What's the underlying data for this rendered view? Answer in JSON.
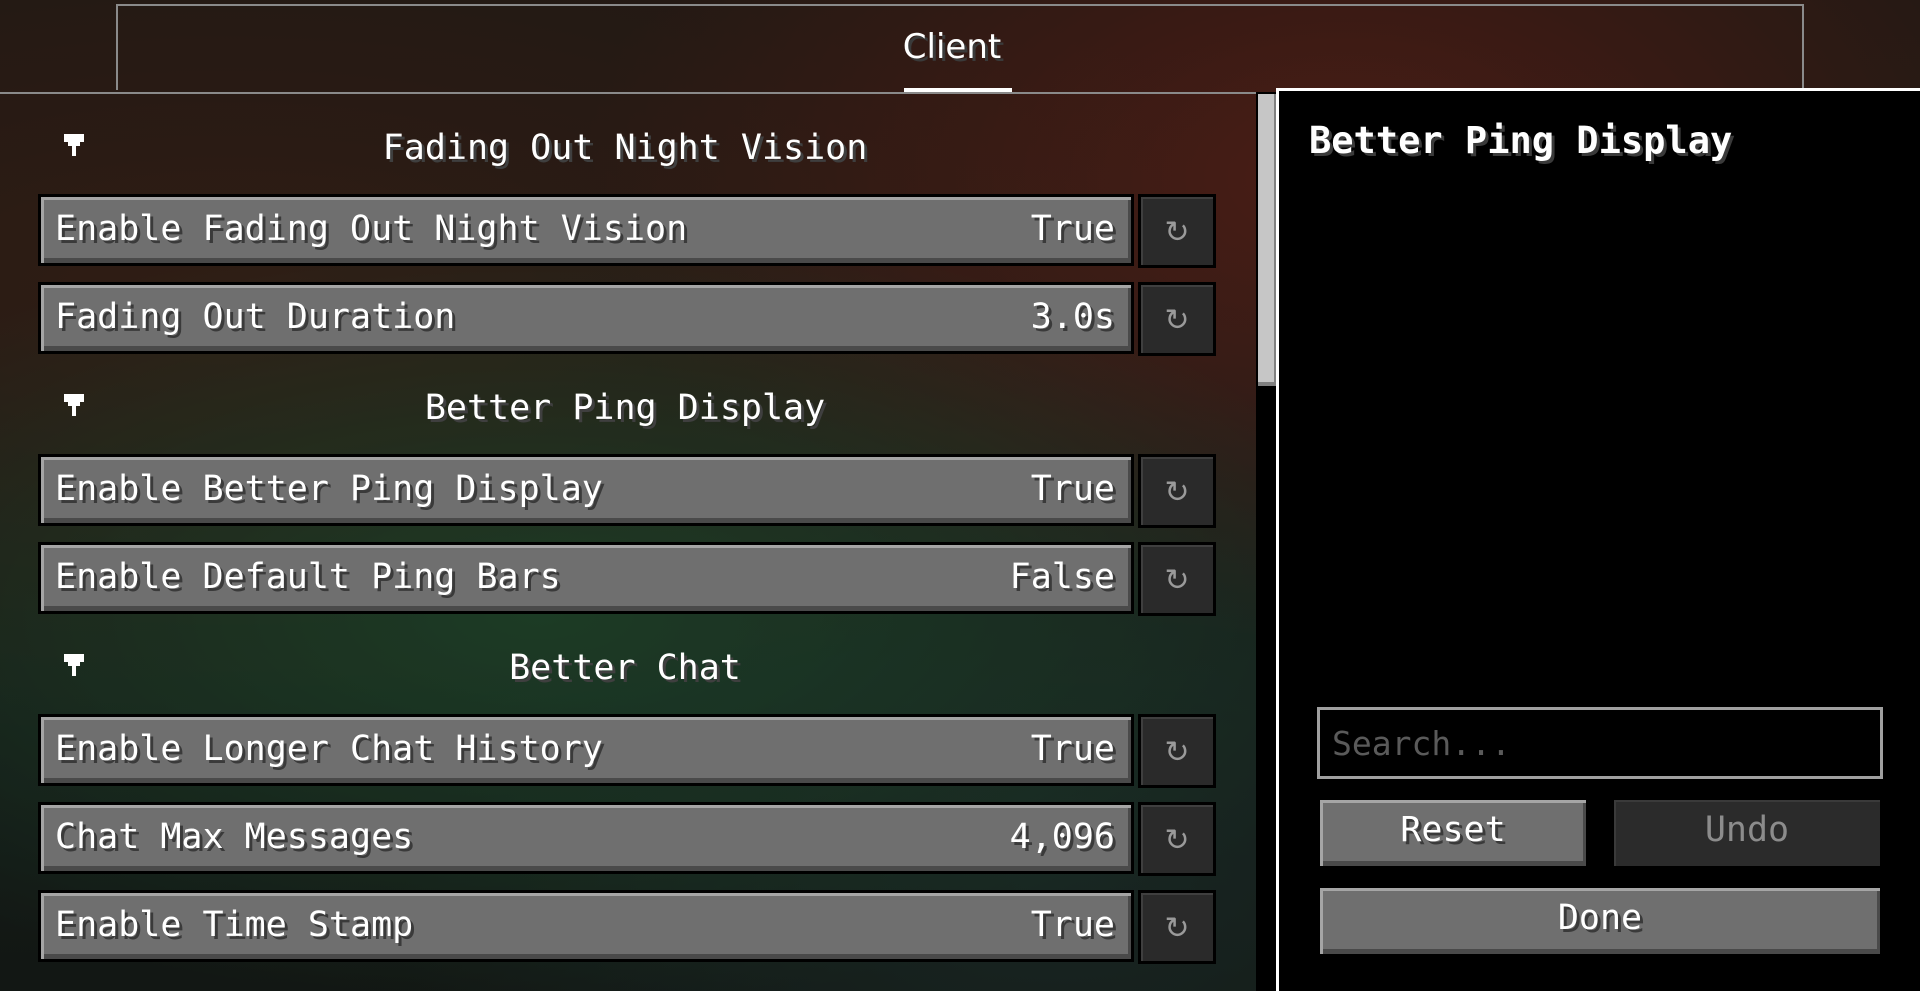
{
  "tab": {
    "label": "Client"
  },
  "sections": [
    {
      "title": "Fading Out Night Vision",
      "rows": [
        {
          "label": "Enable Fading Out Night Vision",
          "value": "True"
        },
        {
          "label": "Fading Out Duration",
          "value": "3.0s"
        }
      ]
    },
    {
      "title": "Better Ping Display",
      "rows": [
        {
          "label": "Enable Better Ping Display",
          "value": "True"
        },
        {
          "label": "Enable Default Ping Bars",
          "value": "False"
        }
      ]
    },
    {
      "title": "Better Chat",
      "rows": [
        {
          "label": "Enable Longer Chat History",
          "value": "True"
        },
        {
          "label": "Chat Max Messages",
          "value": "4,096"
        },
        {
          "label": "Enable Time Stamp",
          "value": "True"
        }
      ]
    }
  ],
  "reset_icon": "↻",
  "panel": {
    "title": "Better Ping Display",
    "search_placeholder": "Search...",
    "reset_label": "Reset",
    "undo_label": "Undo",
    "done_label": "Done"
  }
}
